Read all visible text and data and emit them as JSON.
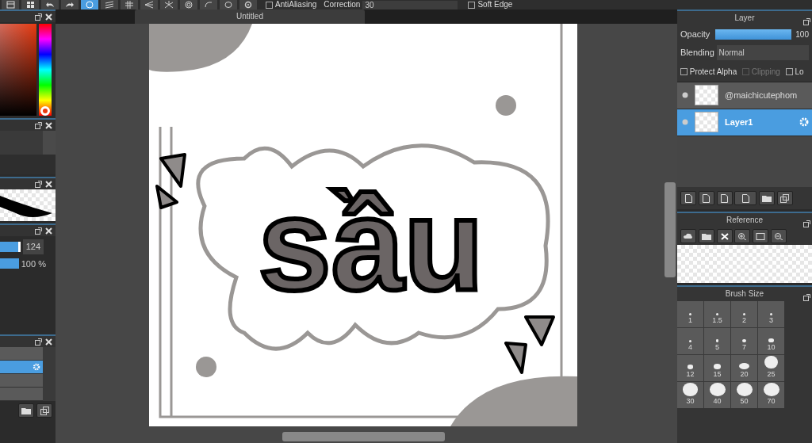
{
  "toolbar": {
    "tools": [
      {
        "kind": "panel",
        "selected": false
      },
      {
        "kind": "grid",
        "selected": false
      },
      {
        "kind": "undo",
        "selected": false
      },
      {
        "kind": "redo",
        "selected": false
      },
      {
        "kind": "snap-off",
        "selected": true
      },
      {
        "kind": "parallel",
        "selected": false
      },
      {
        "kind": "crosshatch",
        "selected": false
      },
      {
        "kind": "vanish",
        "selected": false
      },
      {
        "kind": "radial",
        "selected": false
      },
      {
        "kind": "concentric",
        "selected": false
      },
      {
        "kind": "curve",
        "selected": false
      },
      {
        "kind": "ellipse",
        "selected": false
      },
      {
        "kind": "settings",
        "selected": false
      }
    ],
    "antialiasing": {
      "label": "AntiAliasing",
      "checked": false
    },
    "correction": {
      "label": "Correction",
      "value": "30"
    },
    "soft_edge": {
      "label": "Soft Edge",
      "checked": false
    }
  },
  "left_panels": {
    "brush_size": {
      "value": "124",
      "level": 0.9
    },
    "brush_opacity": {
      "value": "100 %",
      "level": 1
    },
    "brushes": [
      {
        "selected": false
      },
      {
        "selected": true
      },
      {
        "selected": false
      },
      {
        "selected": false
      }
    ]
  },
  "document_tab": {
    "title": "Untitled"
  },
  "canvas": {
    "lettering": "sầu"
  },
  "layer_panel": {
    "title": "Layer",
    "opacity": {
      "label": "Opacity",
      "level": 1,
      "value": "100"
    },
    "blending_label": "Blending",
    "blending_value": "Normal",
    "options": [
      {
        "label": "Protect Alpha",
        "checked": false,
        "disabled": false
      },
      {
        "label": "Clipping",
        "checked": false,
        "disabled": true
      },
      {
        "label": "Lo",
        "checked": false,
        "disabled": false
      }
    ],
    "layers": [
      {
        "name": "@maichicutephom",
        "selected": false
      },
      {
        "name": "Layer1",
        "selected": true
      }
    ]
  },
  "reference_panel": {
    "title": "Reference"
  },
  "brush_size_panel": {
    "title": "Brush Size",
    "sizes": [
      "1",
      "1.5",
      "2",
      "3",
      "4",
      "5",
      "7",
      "10",
      "12",
      "15",
      "20",
      "25",
      "30",
      "40",
      "50",
      "70"
    ]
  }
}
